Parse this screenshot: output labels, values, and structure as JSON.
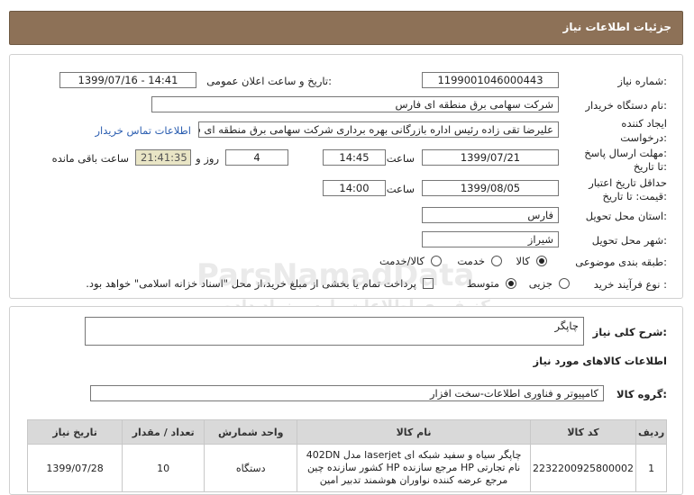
{
  "header": {
    "title": "جزئیات اطلاعات نیاز"
  },
  "fields": {
    "need_number_label": "شماره نیاز:",
    "need_number": "1199001046000443",
    "announce_label": "تاریخ و ساعت اعلان عمومی:",
    "announce_value": "1399/07/16 - 14:41",
    "buyer_org_label": "نام دستگاه خریدار:",
    "buyer_org": "شرکت سهامی برق منطقه ای فارس",
    "creator_label_1": "ایجاد کننده",
    "creator_label_2": "درخواست:",
    "creator": "علیرضا  تقی زاده رئیس اداره بازرگانی بهره برداری شرکت سهامی برق منطقه ای فارس",
    "contact_link": "اطلاعات تماس خریدار",
    "deadline_label_1": "مهلت ارسال پاسخ:",
    "deadline_label_2": "تا تاریخ:",
    "deadline_date": "1399/07/21",
    "time_label": "ساعت",
    "deadline_time": "14:45",
    "days_value": "4",
    "days_label": "روز و",
    "remaining_time": "21:41:35",
    "remaining_label": "ساعت باقی مانده",
    "validity_label_1": "حداقل تاریخ اعتبار",
    "validity_label_2": "قیمت: تا تاریخ:",
    "validity_date": "1399/08/05",
    "validity_time_label": "ساعت",
    "validity_time": "14:00",
    "province_label": "استان محل تحویل:",
    "province": "فارس",
    "city_label": "شهر محل تحویل:",
    "city": "شیراز",
    "category_label": "طبقه بندی موضوعی:",
    "category_options": [
      "کالا",
      "خدمت",
      "کالا/خدمت"
    ],
    "process_label": "نوع فرآیند خرید :",
    "process_options": [
      "جزیی",
      "متوسط"
    ],
    "payment_note": "پرداخت تمام یا بخشی از مبلغ خرید،از محل \"اسناد خزانه اسلامی\" خواهد بود."
  },
  "summary": {
    "label": "شرح کلی نیاز:",
    "value": "چاپگر"
  },
  "goods": {
    "section_title": "اطلاعات کالاهای مورد نیاز",
    "group_label": "گروه کالا:",
    "group_value": "کامپیوتر و فناوری اطلاعات-سخت افزار"
  },
  "table": {
    "headers": [
      "ردیف",
      "کد کالا",
      "نام کالا",
      "واحد شمارش",
      "تعداد / مقدار",
      "تاریخ نیاز"
    ],
    "rows": [
      {
        "index": "1",
        "code": "2232200925800002",
        "name": "چاپگر سیاه و سفید شبکه ای laserjet مدل 402DN نام تجارتی HP مرجع سازنده HP کشور سازنده چین مرجع عرضه کننده نواوران هوشمند تدبیر امین",
        "unit": "دستگاه",
        "qty": "10",
        "date": "1399/07/28"
      }
    ]
  },
  "watermark": {
    "line1": "ParsNamadData",
    "line2": "مرکز فوری اطلاعات پارس نماد داده",
    "line3": "پایگاه اطلاع رسانی مناقصه و مزایده",
    "line4": "۰۲۱-۸۸۳۴۹۶۷۰ - ۵"
  },
  "colors": {
    "header_bg": "#8d7157",
    "timer_bg": "#e9e5c5",
    "link": "#2a5db0",
    "table_header_bg": "#d9d9d9"
  }
}
